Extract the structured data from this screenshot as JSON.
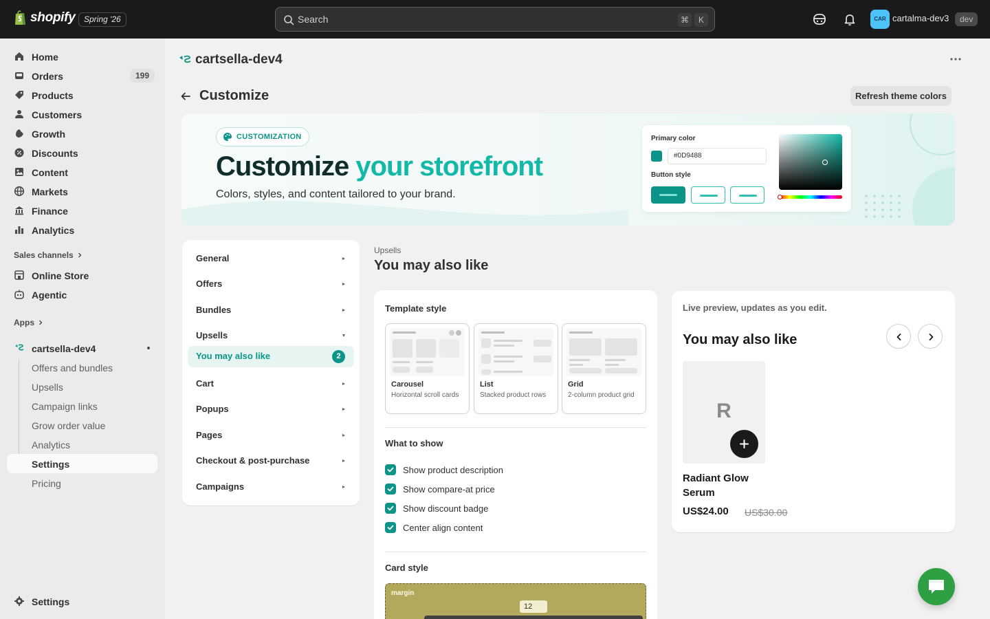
{
  "topbar": {
    "logo_text": "shopify",
    "edition": "Spring '26",
    "search_placeholder": "Search",
    "shortcut_cmd": "⌘",
    "shortcut_key": "K",
    "avatar_initials": "CAR",
    "store_name": "cartalma-dev3",
    "env_badge": "dev"
  },
  "sidebar": {
    "items": [
      {
        "label": "Home",
        "icon": "home-icon"
      },
      {
        "label": "Orders",
        "icon": "orders-icon",
        "badge": "199"
      },
      {
        "label": "Products",
        "icon": "tag-icon"
      },
      {
        "label": "Customers",
        "icon": "person-icon"
      },
      {
        "label": "Growth",
        "icon": "growth-icon"
      },
      {
        "label": "Discounts",
        "icon": "discount-icon"
      },
      {
        "label": "Content",
        "icon": "content-icon"
      },
      {
        "label": "Markets",
        "icon": "globe-icon"
      },
      {
        "label": "Finance",
        "icon": "bank-icon"
      },
      {
        "label": "Analytics",
        "icon": "bar-chart-icon"
      }
    ],
    "sales_channels_label": "Sales channels",
    "channels": [
      {
        "label": "Online Store",
        "icon": "store-icon"
      },
      {
        "label": "Agentic",
        "icon": "robot-icon"
      }
    ],
    "apps_label": "Apps",
    "app_name": "cartsella-dev4",
    "app_subitems": [
      "Offers and bundles",
      "Upsells",
      "Campaign links",
      "Grow order value",
      "Analytics",
      "Settings",
      "Pricing"
    ],
    "active_subitem": "Settings",
    "settings_label": "Settings"
  },
  "main": {
    "app_title": "cartsella-dev4",
    "page_title": "Customize",
    "refresh_button": "Refresh theme colors",
    "hero": {
      "pill": "CUSTOMIZATION",
      "headline_1": "Customize ",
      "headline_accent": "your storefront",
      "subtitle": "Colors, styles, and content tailored to your brand.",
      "primary_color_label": "Primary color",
      "primary_color_value": "#0D9488",
      "button_style_label": "Button style",
      "accent_color": "#0D9488"
    },
    "settings_nav": [
      {
        "label": "General"
      },
      {
        "label": "Offers"
      },
      {
        "label": "Bundles"
      },
      {
        "label": "Upsells"
      },
      {
        "label": "Cart"
      },
      {
        "label": "Popups"
      },
      {
        "label": "Pages"
      },
      {
        "label": "Checkout & post-purchase"
      },
      {
        "label": "Campaigns"
      }
    ],
    "active_nav": {
      "label": "You may also like",
      "count": "2"
    },
    "section_eyebrow": "Upsells",
    "section_title": "You may also like",
    "config": {
      "template_style_label": "Template style",
      "templates": [
        {
          "name": "Carousel",
          "desc": "Horizontal scroll cards"
        },
        {
          "name": "List",
          "desc": "Stacked product rows"
        },
        {
          "name": "Grid",
          "desc": "2-column product grid"
        }
      ],
      "what_to_show_label": "What to show",
      "options": [
        {
          "label": "Show product description",
          "checked": true
        },
        {
          "label": "Show compare-at price",
          "checked": true
        },
        {
          "label": "Show discount badge",
          "checked": true
        },
        {
          "label": "Center align content",
          "checked": true
        }
      ],
      "card_style_label": "Card style",
      "margin_label": "margin",
      "margin_value": "12"
    },
    "preview": {
      "live_label": "Live preview, updates as you edit.",
      "title": "You may also like",
      "product_initial": "R",
      "product_name": "Radiant Glow Serum",
      "price": "US$24.00",
      "compare_price": "US$30.00"
    }
  }
}
